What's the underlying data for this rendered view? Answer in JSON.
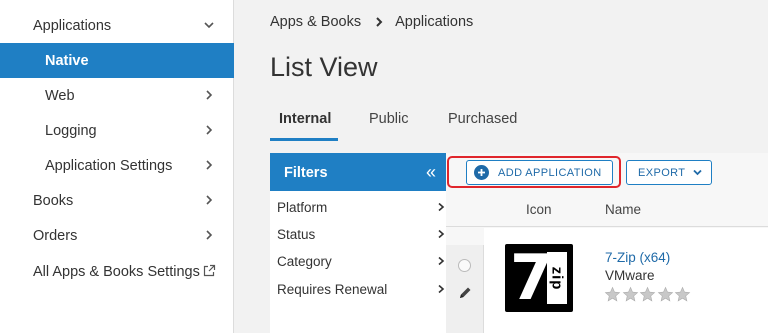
{
  "sidebar": {
    "items": [
      {
        "label": "Applications",
        "level": 0,
        "chevron": "chevron-down-icon"
      },
      {
        "label": "Native",
        "level": 1,
        "active": true
      },
      {
        "label": "Web",
        "level": 1,
        "chevron": "chevron-right-icon"
      },
      {
        "label": "Logging",
        "level": 1,
        "chevron": "chevron-right-icon"
      },
      {
        "label": "Application Settings",
        "level": 1,
        "chevron": "chevron-right-icon"
      },
      {
        "label": "Books",
        "level": 0,
        "chevron": "chevron-right-icon"
      },
      {
        "label": "Orders",
        "level": 0,
        "chevron": "chevron-right-icon"
      },
      {
        "label": "All Apps & Books Settings",
        "level": 0,
        "icon": "external-link-icon"
      }
    ]
  },
  "breadcrumb": {
    "parent": "Apps & Books",
    "current": "Applications"
  },
  "page_title": "List View",
  "tabs": [
    {
      "label": "Internal",
      "active": true
    },
    {
      "label": "Public"
    },
    {
      "label": "Purchased"
    }
  ],
  "filters": {
    "title": "Filters",
    "collapse_glyph": "«",
    "items": [
      "Platform",
      "Status",
      "Category",
      "Requires Renewal"
    ]
  },
  "toolbar": {
    "add_label": "ADD APPLICATION",
    "export_label": "EXPORT"
  },
  "grid": {
    "columns": [
      "Icon",
      "Name"
    ],
    "rows": [
      {
        "name": "7-Zip (x64)",
        "vendor": "VMware",
        "rating": 0,
        "icon_main": "7",
        "icon_side": "zip"
      }
    ]
  },
  "colors": {
    "accent": "#1f7fc4",
    "highlight": "#e0262c",
    "link": "#1f6aa8"
  }
}
